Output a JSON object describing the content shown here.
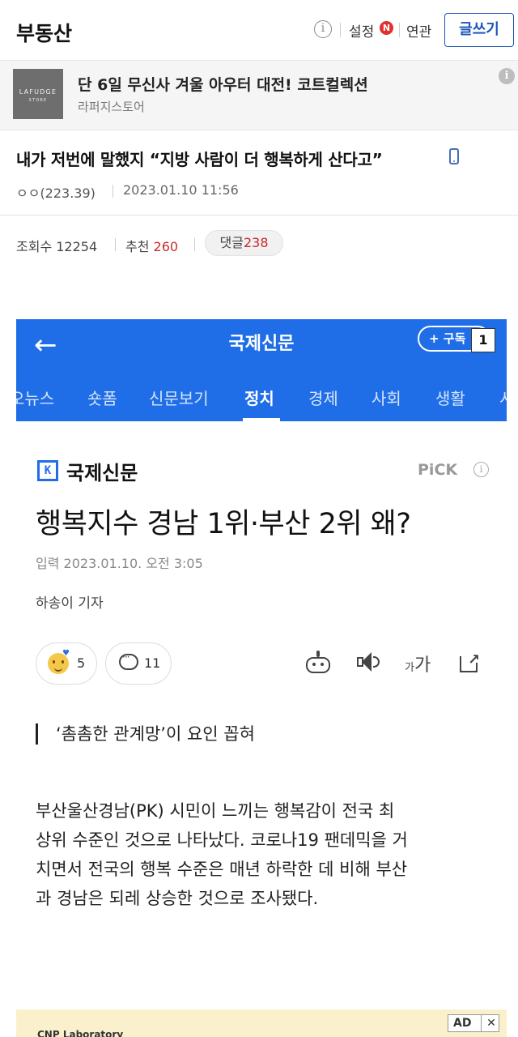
{
  "header": {
    "board_title": "부동산",
    "info_icon": "ⓘ",
    "settings_label": "설정",
    "settings_badge": "N",
    "related_label": "연관",
    "write_button": "글쓰기"
  },
  "promo": {
    "thumb_text": "LAFUDGE",
    "thumb_subtext": "STORE",
    "title": "단 6일 무신사 겨울 아우터 대전! 코트컬렉션",
    "subtitle": "라퍼지스토어",
    "info_icon": "i"
  },
  "post": {
    "title": "내가 저번에 말했지 “지방 사람이 더 행복하게 산다고”",
    "author": "ㅇㅇ(223.39)",
    "date": "2023.01.10 11:56",
    "views_label": "조회수 12254",
    "recommend_label": "추천",
    "recommend_count": "260",
    "comments_label": "댓글",
    "comments_count": "238"
  },
  "embedded_app": {
    "back_arrow": "←",
    "title": "국제신문",
    "subscribe_label": "+ 구독",
    "badge_number": "1",
    "tabs": [
      "오뉴스",
      "숏폼",
      "신문보기",
      "정치",
      "경제",
      "사회",
      "생활",
      "시"
    ],
    "active_tab": "정치"
  },
  "article": {
    "press_logo": "K",
    "press_name": "국제신문",
    "pick_label": "PiCK",
    "pick_info": "i",
    "headline": "행복지수 경남 1위·부산 2위 왜?",
    "input_date": "입력 2023.01.10. 오전 3:05",
    "reporter": "하송이 기자",
    "reaction_count": "5",
    "comment_count": "11",
    "font_small": "가",
    "font_big": "가",
    "subheading": "‘촘촘한 관계망’이 요인 꼽혀",
    "body_lines": [
      "부산울산경남(PK) 시민이 느끼는 행복감이 전국 최",
      "상위 수준인 것으로 나타났다. 코로나19 팬데믹을 거",
      "치면서 전국의 행복 수준은 매년 하락한 데 비해 부산",
      "과 경남은 되레 상승한 것으로 조사됐다."
    ]
  },
  "bottom_ad": {
    "ad_label": "AD",
    "close_label": "✕",
    "brand": "CNP Laboratory"
  }
}
